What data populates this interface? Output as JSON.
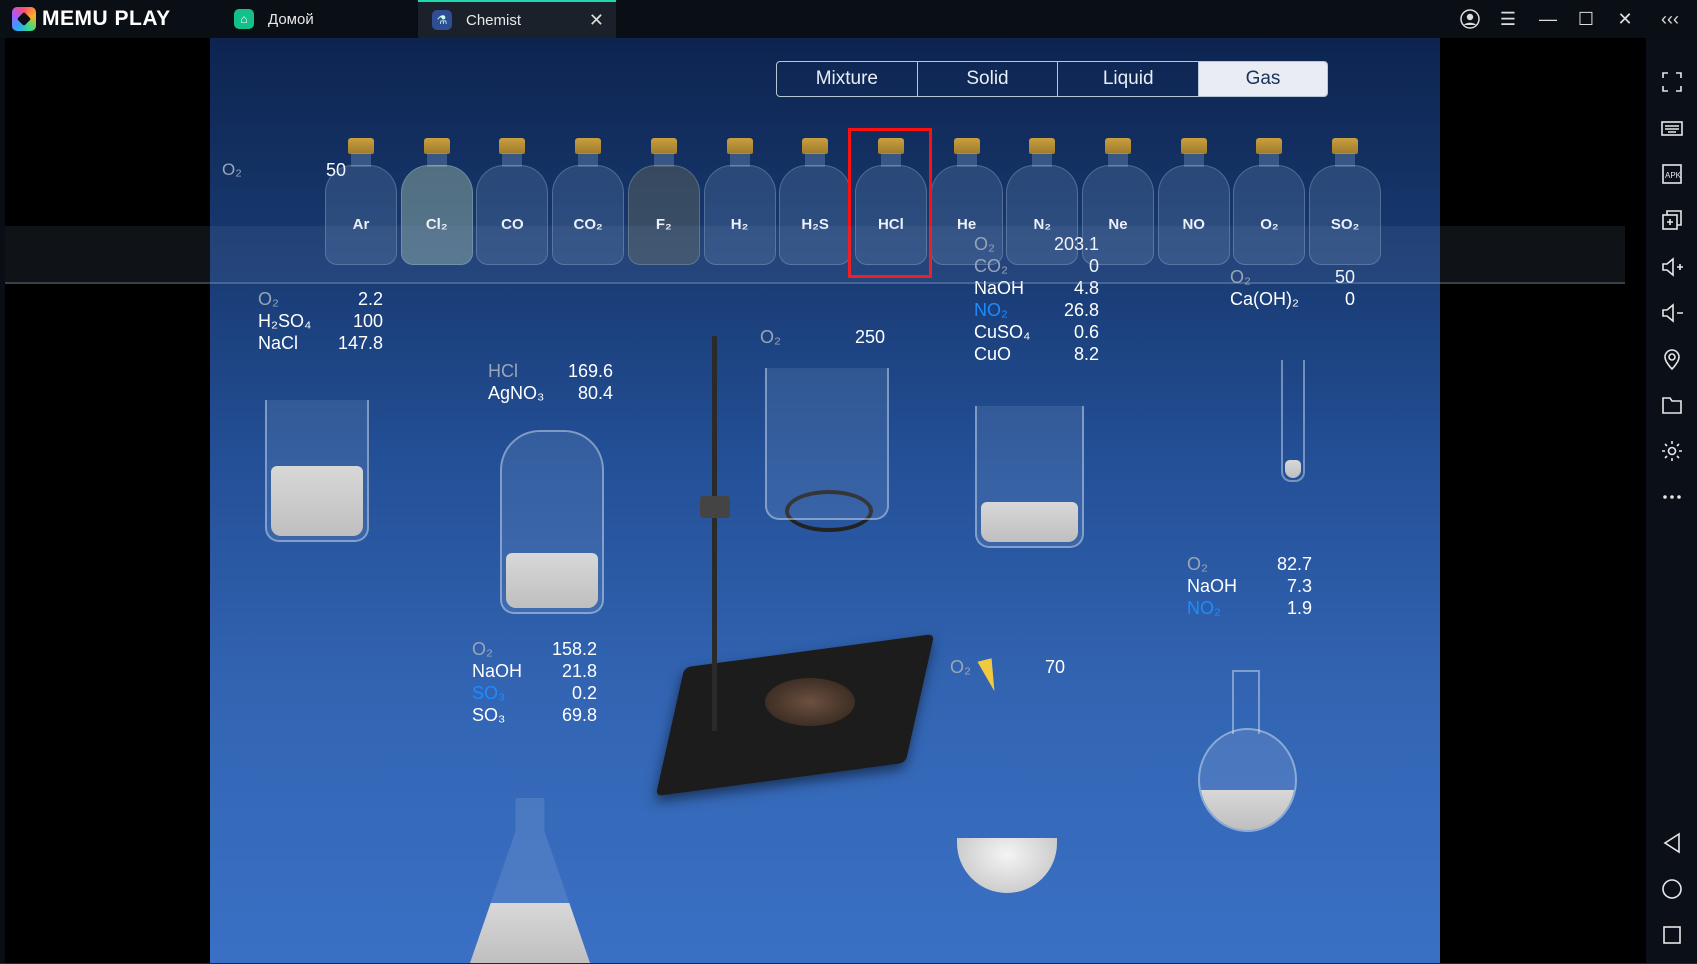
{
  "app": {
    "brand": "MEMU PLAY",
    "tabs": [
      {
        "label": "Домой",
        "icon": "home-icon",
        "active": false
      },
      {
        "label": "Chemist",
        "icon": "chemist-app-icon",
        "active": true
      }
    ],
    "window_controls": [
      "account-icon",
      "menu-icon",
      "minimize-icon",
      "maximize-icon",
      "close-icon",
      "collapse-sidebar-icon"
    ],
    "accent_color": "#1ed9b0"
  },
  "sidebar": {
    "items": [
      {
        "name": "fullscreen",
        "icon": "fullscreen-icon"
      },
      {
        "name": "keyboard",
        "icon": "keyboard-icon"
      },
      {
        "name": "apk",
        "icon": "apk-icon"
      },
      {
        "name": "multi-instance",
        "icon": "multi-window-icon"
      },
      {
        "name": "volume-up",
        "icon": "volume-up-icon"
      },
      {
        "name": "volume-down",
        "icon": "volume-down-icon"
      },
      {
        "name": "location",
        "icon": "location-icon"
      },
      {
        "name": "folder",
        "icon": "folder-icon"
      },
      {
        "name": "settings",
        "icon": "gear-icon"
      },
      {
        "name": "more",
        "icon": "more-icon"
      },
      {
        "name": "back",
        "icon": "back-icon"
      },
      {
        "name": "home",
        "icon": "home-circle-icon"
      },
      {
        "name": "recents",
        "icon": "recents-icon"
      }
    ]
  },
  "game": {
    "categories": [
      "Mixture",
      "Solid",
      "Liquid",
      "Gas"
    ],
    "active_category": "Gas",
    "gases": [
      "Ar",
      "Cl₂",
      "CO",
      "CO₂",
      "F₂",
      "H₂",
      "H₂S",
      "HCl",
      "He",
      "N₂",
      "Ne",
      "NO",
      "O₂",
      "SO₂"
    ],
    "selected_gas": "HCl",
    "selection_color": "#ff1010",
    "shelf_readout": {
      "label": "O₂",
      "value": "50"
    },
    "readouts": [
      {
        "id": "beaker-left",
        "rows": [
          {
            "label": "O₂",
            "value": "2.2",
            "style": "dim"
          },
          {
            "label": "H₂SO₄",
            "value": "100"
          },
          {
            "label": "NaCl",
            "value": "147.8"
          }
        ]
      },
      {
        "id": "bottle-agno3",
        "rows": [
          {
            "label": "HCl",
            "value": "169.6",
            "style": "dim"
          },
          {
            "label": "AgNO₃",
            "value": "80.4"
          }
        ]
      },
      {
        "id": "beaker-ring",
        "rows": [
          {
            "label": "O₂",
            "value": "250",
            "style": "dim"
          }
        ]
      },
      {
        "id": "beaker-center",
        "rows": [
          {
            "label": "O₂",
            "value": "203.1",
            "style": "dim"
          },
          {
            "label": "CO₂",
            "value": "0",
            "style": "dim"
          },
          {
            "label": "NaOH",
            "value": "4.8"
          },
          {
            "label": "NO₂",
            "value": "26.8",
            "style": "blue"
          },
          {
            "label": "CuSO₄",
            "value": "0.6"
          },
          {
            "label": "CuO",
            "value": "8.2"
          }
        ]
      },
      {
        "id": "test-tube",
        "rows": [
          {
            "label": "O₂",
            "value": "50",
            "style": "dim"
          },
          {
            "label": "Ca(OH)₂",
            "value": "0"
          }
        ]
      },
      {
        "id": "round-flask",
        "rows": [
          {
            "label": "O₂",
            "value": "82.7",
            "style": "dim"
          },
          {
            "label": "NaOH",
            "value": "7.3"
          },
          {
            "label": "NO₂",
            "value": "1.9",
            "style": "blue"
          }
        ]
      },
      {
        "id": "erlenmeyer",
        "rows": [
          {
            "label": "O₂",
            "value": "158.2",
            "style": "dim"
          },
          {
            "label": "NaOH",
            "value": "21.8"
          },
          {
            "label": "SO₃",
            "value": "0.2",
            "style": "blue"
          },
          {
            "label": "SO₃",
            "value": "69.8"
          }
        ]
      },
      {
        "id": "dish",
        "rows": [
          {
            "label": "O₂",
            "value": "70",
            "style": "dim"
          }
        ]
      }
    ]
  }
}
